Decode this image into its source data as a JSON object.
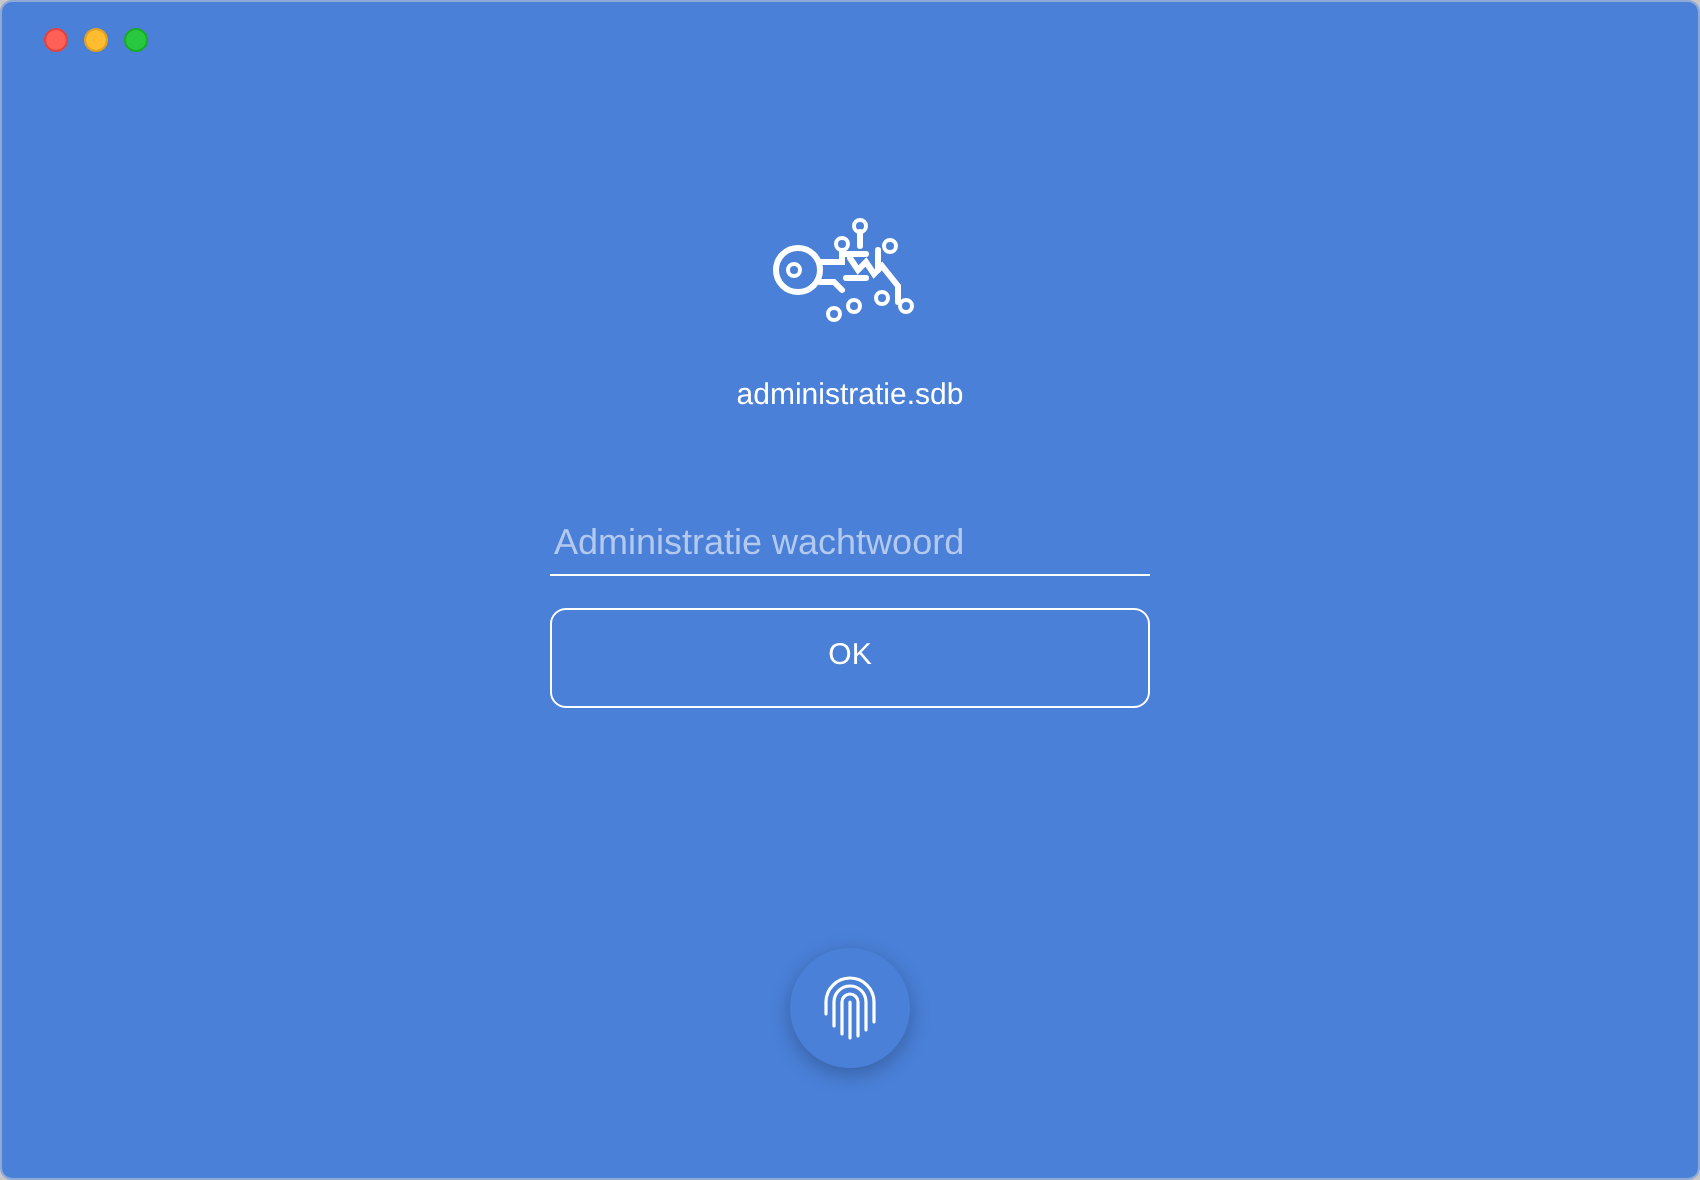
{
  "file_name": "administratie.sdb",
  "password": {
    "placeholder": "Administratie wachtwoord"
  },
  "ok_button": "OK"
}
